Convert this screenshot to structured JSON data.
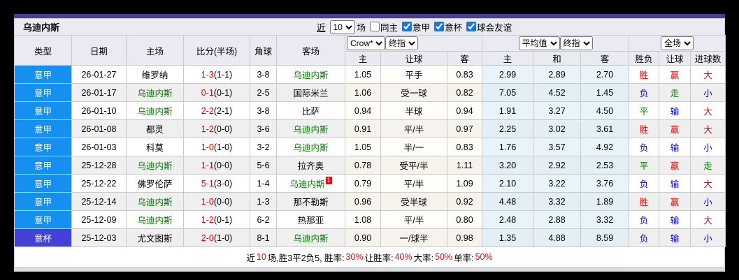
{
  "colors": {
    "accent_purple": "#4a3d94",
    "serie_a_blue": "#1590f0",
    "cup_purple": "#4341d8",
    "win_red": "#ee0000",
    "draw_green": "#008000",
    "lose_blue": "#0000ee",
    "udinese_green": "#008000"
  },
  "title": "乌迪内斯",
  "controls": {
    "recent_label": "近",
    "count": "10",
    "matches_label": "场",
    "checkboxes": [
      {
        "label": "同主",
        "checked": false
      },
      {
        "label": "意甲",
        "checked": true
      },
      {
        "label": "意杯",
        "checked": true
      },
      {
        "label": "球会友谊",
        "checked": true
      }
    ]
  },
  "header": {
    "dropdowns": {
      "bookmaker": "Crow*",
      "bookmaker_final": "终指",
      "average": "平均值",
      "average_final": "终指",
      "scope": "全场"
    },
    "columns": [
      "类型",
      "日期",
      "主场",
      "比分(半场)",
      "角球",
      "客场"
    ],
    "odds_columns": [
      "主",
      "让球",
      "客"
    ],
    "avg_columns": [
      "主",
      "和",
      "客"
    ],
    "result_columns": [
      "胜负",
      "让球",
      "进球数"
    ]
  },
  "rows": [
    {
      "league": "意甲",
      "league_type": "serie-a",
      "date": "26-01-27",
      "home": "维罗纳",
      "home_udinese": false,
      "score": "1-3",
      "half": "(1-1)",
      "corner": "3-8",
      "away": "乌迪内斯",
      "away_udinese": true,
      "away_badge": "",
      "odds": [
        "1.05",
        "平手",
        "0.83"
      ],
      "avg": [
        "2.99",
        "2.89",
        "2.70"
      ],
      "results": [
        "胜",
        "赢",
        "大"
      ]
    },
    {
      "league": "意甲",
      "league_type": "serie-a",
      "date": "26-01-17",
      "home": "乌迪内斯",
      "home_udinese": true,
      "score": "0-1",
      "half": "(0-1)",
      "corner": "2-5",
      "away": "国际米兰",
      "away_udinese": false,
      "away_badge": "",
      "odds": [
        "1.06",
        "受一球",
        "0.82"
      ],
      "avg": [
        "7.05",
        "4.52",
        "1.45"
      ],
      "results": [
        "负",
        "走",
        "小"
      ]
    },
    {
      "league": "意甲",
      "league_type": "serie-a",
      "date": "26-01-10",
      "home": "乌迪内斯",
      "home_udinese": true,
      "score": "2-2",
      "half": "(2-1)",
      "corner": "3-8",
      "away": "比萨",
      "away_udinese": false,
      "away_badge": "",
      "odds": [
        "0.94",
        "半球",
        "0.94"
      ],
      "avg": [
        "1.91",
        "3.27",
        "4.50"
      ],
      "results": [
        "平",
        "输",
        "大"
      ]
    },
    {
      "league": "意甲",
      "league_type": "serie-a",
      "date": "26-01-08",
      "home": "都灵",
      "home_udinese": false,
      "score": "1-2",
      "half": "(0-0)",
      "corner": "3-6",
      "away": "乌迪内斯",
      "away_udinese": true,
      "away_badge": "",
      "odds": [
        "0.91",
        "平/半",
        "0.97"
      ],
      "avg": [
        "2.25",
        "3.02",
        "3.61"
      ],
      "results": [
        "胜",
        "赢",
        "大"
      ]
    },
    {
      "league": "意甲",
      "league_type": "serie-a",
      "date": "26-01-03",
      "home": "科莫",
      "home_udinese": false,
      "score": "1-0",
      "half": "(1-0)",
      "corner": "3-2",
      "away": "乌迪内斯",
      "away_udinese": true,
      "away_badge": "",
      "odds": [
        "1.05",
        "半/一",
        "0.83"
      ],
      "avg": [
        "1.76",
        "3.57",
        "4.92"
      ],
      "results": [
        "负",
        "输",
        "小"
      ]
    },
    {
      "league": "意甲",
      "league_type": "serie-a",
      "date": "25-12-28",
      "home": "乌迪内斯",
      "home_udinese": true,
      "score": "1-1",
      "half": "(0-0)",
      "corner": "5-6",
      "away": "拉齐奥",
      "away_udinese": false,
      "away_badge": "",
      "odds": [
        "0.78",
        "受平/半",
        "1.11"
      ],
      "avg": [
        "3.20",
        "2.92",
        "2.53"
      ],
      "results": [
        "平",
        "赢",
        "走"
      ]
    },
    {
      "league": "意甲",
      "league_type": "serie-a",
      "date": "25-12-22",
      "home": "佛罗伦萨",
      "home_udinese": false,
      "score": "5-1",
      "half": "(3-0)",
      "corner": "1-4",
      "away": "乌迪内斯",
      "away_udinese": true,
      "away_badge": "1",
      "odds": [
        "0.79",
        "平/半",
        "1.09"
      ],
      "avg": [
        "2.10",
        "3.22",
        "3.76"
      ],
      "results": [
        "负",
        "输",
        "大"
      ]
    },
    {
      "league": "意甲",
      "league_type": "serie-a",
      "date": "25-12-14",
      "home": "乌迪内斯",
      "home_udinese": true,
      "score": "1-0",
      "half": "(0-0)",
      "corner": "1-3",
      "away": "那不勒斯",
      "away_udinese": false,
      "away_badge": "",
      "odds": [
        "0.96",
        "受半球",
        "0.92"
      ],
      "avg": [
        "4.48",
        "3.32",
        "1.89"
      ],
      "results": [
        "胜",
        "赢",
        "小"
      ]
    },
    {
      "league": "意甲",
      "league_type": "serie-a",
      "date": "25-12-09",
      "home": "乌迪内斯",
      "home_udinese": true,
      "score": "1-2",
      "half": "(0-1)",
      "corner": "6-2",
      "away": "热那亚",
      "away_udinese": false,
      "away_badge": "",
      "odds": [
        "1.08",
        "平/半",
        "0.80"
      ],
      "avg": [
        "2.48",
        "2.88",
        "3.32"
      ],
      "results": [
        "负",
        "输",
        "大"
      ]
    },
    {
      "league": "意杯",
      "league_type": "cup",
      "date": "25-12-03",
      "home": "尤文图斯",
      "home_udinese": false,
      "score": "2-0",
      "half": "(1-0)",
      "corner": "8-1",
      "away": "乌迪内斯",
      "away_udinese": true,
      "away_badge": "",
      "odds": [
        "0.90",
        "一/球半",
        "0.98"
      ],
      "avg": [
        "1.35",
        "4.88",
        "8.59"
      ],
      "results": [
        "负",
        "输",
        "小"
      ]
    }
  ],
  "footer": {
    "segments": [
      {
        "text": "近",
        "color": "black"
      },
      {
        "text": "10",
        "color": "red"
      },
      {
        "text": "场,胜3平2负5, 胜率:",
        "color": "black"
      },
      {
        "text": "30%",
        "color": "red"
      },
      {
        "text": " 让胜率:",
        "color": "black"
      },
      {
        "text": "40%",
        "color": "red"
      },
      {
        "text": " 大率:",
        "color": "black"
      },
      {
        "text": "50%",
        "color": "red"
      },
      {
        "text": " 单率:",
        "color": "black"
      },
      {
        "text": "50%",
        "color": "red"
      }
    ]
  }
}
